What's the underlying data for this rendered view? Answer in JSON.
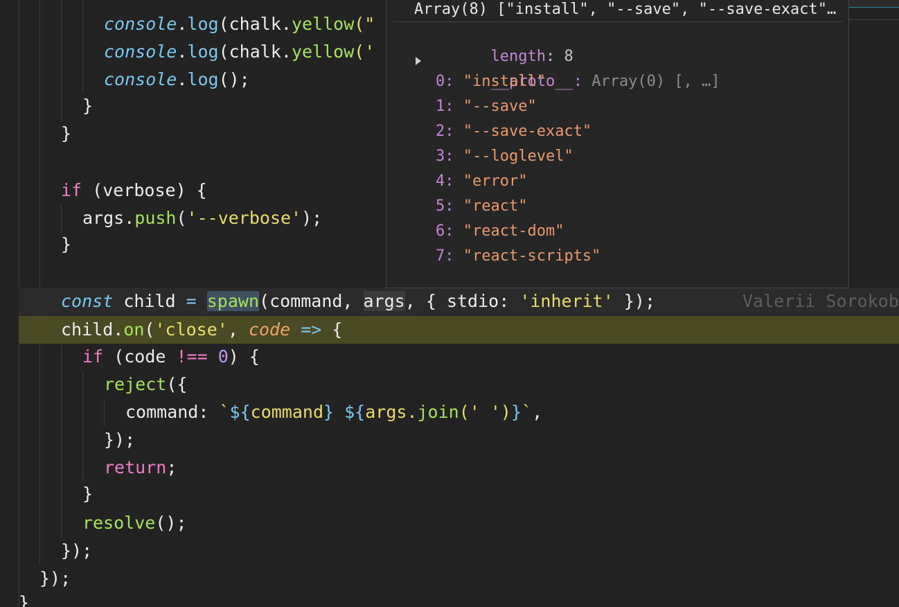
{
  "editor": {
    "lines": [
      {
        "id": "line-console-log-1",
        "tokens": [
          {
            "t": "console",
            "c": "t-obj"
          },
          {
            "t": ".",
            "c": "t-plain"
          },
          {
            "t": "log",
            "c": "t-op"
          },
          {
            "t": "(chalk.",
            "c": "t-plain"
          },
          {
            "t": "yellow",
            "c": "t-fn"
          },
          {
            "t": "(\"",
            "c": "t-str"
          }
        ]
      },
      {
        "id": "line-console-log-2",
        "tokens": [
          {
            "t": "console",
            "c": "t-obj"
          },
          {
            "t": ".",
            "c": "t-plain"
          },
          {
            "t": "log",
            "c": "t-op"
          },
          {
            "t": "(chalk.",
            "c": "t-plain"
          },
          {
            "t": "yellow",
            "c": "t-fn"
          },
          {
            "t": "('",
            "c": "t-str"
          }
        ]
      },
      {
        "id": "line-console-log-3",
        "tokens": [
          {
            "t": "console",
            "c": "t-obj"
          },
          {
            "t": ".",
            "c": "t-plain"
          },
          {
            "t": "log",
            "c": "t-op"
          },
          {
            "t": "();",
            "c": "t-plain"
          }
        ]
      },
      {
        "id": "line-close-brace-1",
        "tokens": [
          {
            "t": "}",
            "c": "t-plain"
          }
        ]
      },
      {
        "id": "line-close-brace-2",
        "tokens": [
          {
            "t": "}",
            "c": "t-plain"
          }
        ]
      },
      {
        "id": "line-if-verbose",
        "tokens": [
          {
            "t": "if",
            "c": "t-kw"
          },
          {
            "t": " (verbose) {",
            "c": "t-plain"
          }
        ]
      },
      {
        "id": "line-args-push",
        "tokens": [
          {
            "t": "args.",
            "c": "t-plain"
          },
          {
            "t": "push",
            "c": "t-fn"
          },
          {
            "t": "(",
            "c": "t-plain"
          },
          {
            "t": "'--verbose'",
            "c": "t-str"
          },
          {
            "t": ");",
            "c": "t-plain"
          }
        ]
      },
      {
        "id": "line-close-brace-3",
        "tokens": [
          {
            "t": "}",
            "c": "t-plain"
          }
        ]
      },
      {
        "id": "line-const-child",
        "tokens": [
          {
            "t": "const",
            "c": "t-storage"
          },
          {
            "t": " child ",
            "c": "t-plain"
          },
          {
            "t": "=",
            "c": "t-op"
          },
          {
            "t": " ",
            "c": "t-plain"
          },
          {
            "t": "spawn",
            "c": "t-fn word-hl"
          },
          {
            "t": "(command, ",
            "c": "t-plain"
          },
          {
            "t": "args",
            "c": "t-plain word-hl2"
          },
          {
            "t": ", { stdio: ",
            "c": "t-plain"
          },
          {
            "t": "'inherit'",
            "c": "t-str"
          },
          {
            "t": " });",
            "c": "t-plain"
          }
        ]
      },
      {
        "id": "line-child-on",
        "tokens": [
          {
            "t": "child.",
            "c": "t-plain"
          },
          {
            "t": "on",
            "c": "t-fn"
          },
          {
            "t": "(",
            "c": "t-plain"
          },
          {
            "t": "'close'",
            "c": "t-str"
          },
          {
            "t": ", ",
            "c": "t-plain"
          },
          {
            "t": "code",
            "c": "t-var"
          },
          {
            "t": " ",
            "c": "t-plain"
          },
          {
            "t": "=>",
            "c": "t-op"
          },
          {
            "t": " {",
            "c": "t-plain"
          }
        ]
      },
      {
        "id": "line-if-code",
        "tokens": [
          {
            "t": "if",
            "c": "t-kw"
          },
          {
            "t": " (code ",
            "c": "t-plain"
          },
          {
            "t": "!==",
            "c": "t-kw"
          },
          {
            "t": " ",
            "c": "t-plain"
          },
          {
            "t": "0",
            "c": "t-num"
          },
          {
            "t": ") {",
            "c": "t-plain"
          }
        ]
      },
      {
        "id": "line-reject",
        "tokens": [
          {
            "t": "reject",
            "c": "t-fn"
          },
          {
            "t": "({",
            "c": "t-plain"
          }
        ]
      },
      {
        "id": "line-command",
        "tokens": [
          {
            "t": "command: ",
            "c": "t-plain"
          },
          {
            "t": "`",
            "c": "t-tmpl"
          },
          {
            "t": "${",
            "c": "t-interp"
          },
          {
            "t": "command",
            "c": "t-tmpl"
          },
          {
            "t": "}",
            "c": "t-interp"
          },
          {
            "t": " ",
            "c": "t-tmpl"
          },
          {
            "t": "${",
            "c": "t-interp"
          },
          {
            "t": "args.",
            "c": "t-tmpl"
          },
          {
            "t": "join",
            "c": "t-fn"
          },
          {
            "t": "(' ')",
            "c": "t-tmpl"
          },
          {
            "t": "}",
            "c": "t-interp"
          },
          {
            "t": "`",
            "c": "t-tmpl"
          },
          {
            "t": ",",
            "c": "t-plain"
          }
        ]
      },
      {
        "id": "line-close-reject",
        "tokens": [
          {
            "t": "});",
            "c": "t-plain"
          }
        ]
      },
      {
        "id": "line-return",
        "tokens": [
          {
            "t": "return",
            "c": "t-kw"
          },
          {
            "t": ";",
            "c": "t-plain"
          }
        ]
      },
      {
        "id": "line-close-brace-4",
        "tokens": [
          {
            "t": "}",
            "c": "t-plain"
          }
        ]
      },
      {
        "id": "line-resolve",
        "tokens": [
          {
            "t": "resolve",
            "c": "t-fn"
          },
          {
            "t": "();",
            "c": "t-plain"
          }
        ]
      },
      {
        "id": "line-close-on",
        "tokens": [
          {
            "t": "});",
            "c": "t-plain"
          }
        ]
      },
      {
        "id": "line-close-promise",
        "tokens": [
          {
            "t": "});",
            "c": "t-plain"
          }
        ]
      },
      {
        "id": "line-final-brace",
        "tokens": [
          {
            "t": "}",
            "c": "t-plain"
          }
        ]
      }
    ],
    "blame": "Valerii Sorokob"
  },
  "hover": {
    "header": "Array(8) [\"install\", \"--save\", \"--save-exact\"…",
    "length_key": "length",
    "length_sep": ": ",
    "length_value": "8",
    "proto_key": "__proto__",
    "proto_sep": ": ",
    "proto_value": "Array(0) [, …]",
    "items": [
      {
        "index": "0",
        "value": "\"install\""
      },
      {
        "index": "1",
        "value": "\"--save\""
      },
      {
        "index": "2",
        "value": "\"--save-exact\""
      },
      {
        "index": "3",
        "value": "\"--loglevel\""
      },
      {
        "index": "4",
        "value": "\"error\""
      },
      {
        "index": "5",
        "value": "\"react\""
      },
      {
        "index": "6",
        "value": "\"react-dom\""
      },
      {
        "index": "7",
        "value": "\"react-scripts\""
      }
    ]
  }
}
